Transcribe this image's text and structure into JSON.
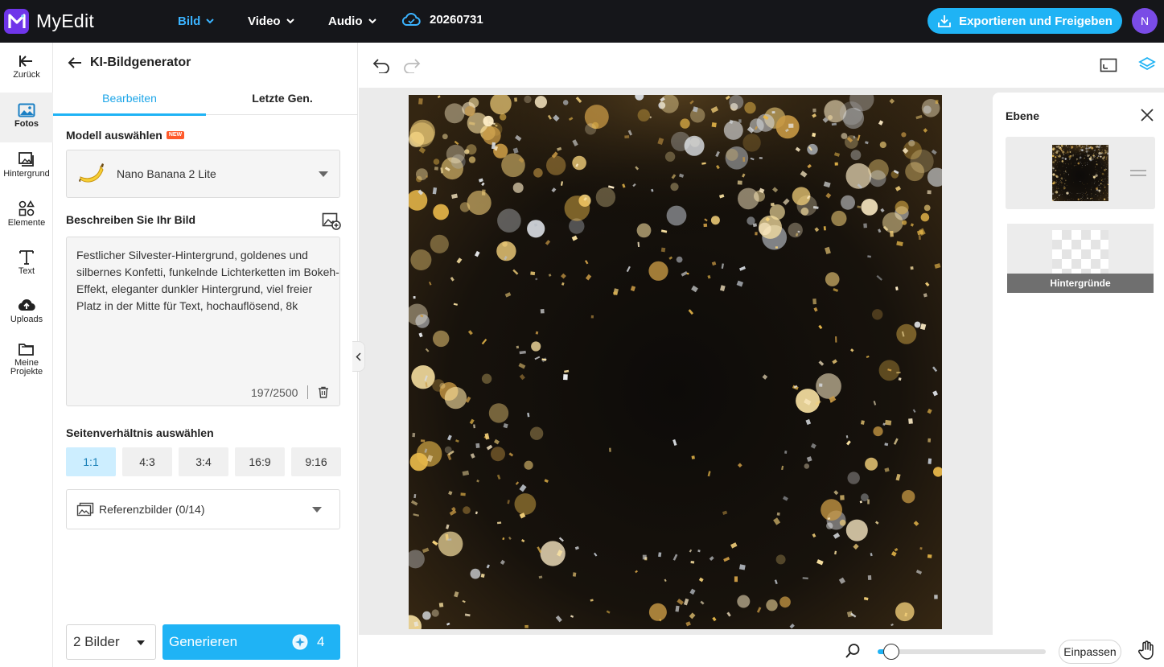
{
  "app": {
    "name": "MyEdit"
  },
  "topnav": {
    "items": [
      {
        "label": "Bild"
      },
      {
        "label": "Video"
      },
      {
        "label": "Audio"
      }
    ],
    "project_name": "20260731",
    "export_label": "Exportieren und Freigeben",
    "avatar_initial": "N"
  },
  "rail": {
    "items": [
      {
        "label": "Zurück",
        "icon": "arrow-left-icon"
      },
      {
        "label": "Fotos",
        "icon": "image-icon"
      },
      {
        "label": "Hintergrund",
        "icon": "background-icon"
      },
      {
        "label": "Elemente",
        "icon": "shapes-icon"
      },
      {
        "label": "Text",
        "icon": "text-icon"
      },
      {
        "label": "Uploads",
        "icon": "cloud-upload-icon"
      },
      {
        "label": "Meine Projekte",
        "icon": "folder-icon"
      }
    ]
  },
  "panel": {
    "title": "KI-Bildgenerator",
    "tabs": [
      {
        "label": "Bearbeiten"
      },
      {
        "label": "Letzte Gen."
      }
    ],
    "model_label": "Modell auswählen",
    "model_badge": "NEW",
    "model_value": "Nano Banana 2 Lite",
    "describe_label": "Beschreiben Sie Ihr Bild",
    "prompt": "Festlicher Silvester-Hintergrund, goldenes und silbernes Konfetti, funkelnde Lichterketten im Bokeh-Effekt, eleganter dunkler Hintergrund, viel freier Platz in der Mitte für Text, hochauflösend, 8k",
    "char_count": "197/2500",
    "ratio_label": "Seitenverhältnis auswählen",
    "ratios": [
      {
        "label": "1:1"
      },
      {
        "label": "4:3"
      },
      {
        "label": "3:4"
      },
      {
        "label": "16:9"
      },
      {
        "label": "9:16"
      }
    ],
    "selected_ratio": "1:1",
    "reference_label": "Referenzbilder (0/14)",
    "image_count": "2 Bilder",
    "generate_label": "Generieren",
    "credits": "4"
  },
  "layers": {
    "title": "Ebene",
    "background_label": "Hintergründe"
  },
  "bottom": {
    "fit_label": "Einpassen",
    "zoom_fraction": 0.08
  },
  "colors": {
    "accent": "#1fb3f5",
    "brand": "#6f35ea",
    "topbar": "#15161a",
    "active_nav": "#3bb3ff",
    "gold": "#e8b84a"
  }
}
